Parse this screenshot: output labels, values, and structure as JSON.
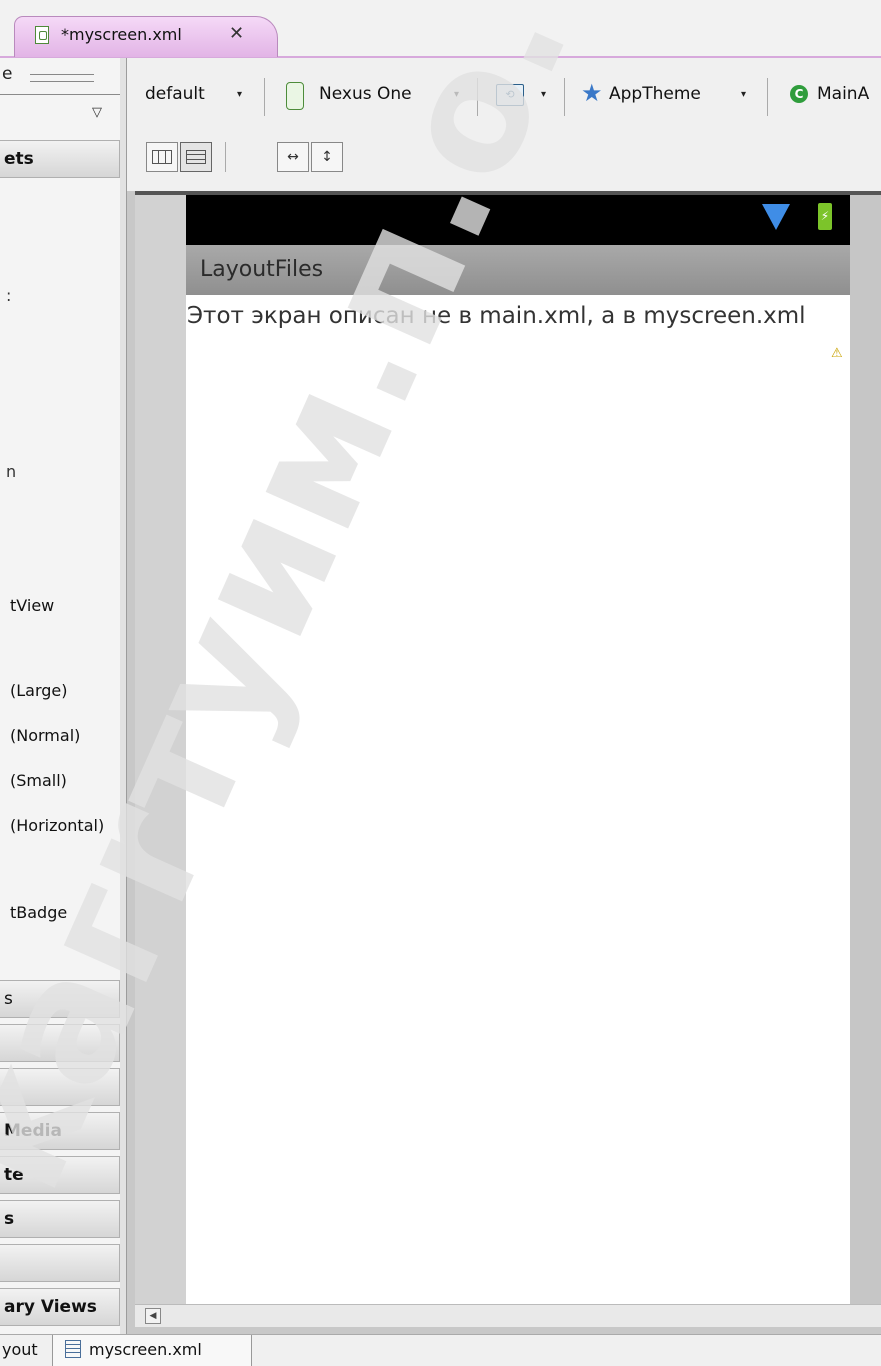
{
  "editor_tab": {
    "title": "*myscreen.xml",
    "close_glyph": "✕"
  },
  "palette": {
    "search_fragment": "e",
    "headers": [
      "ets",
      "s",
      "",
      "",
      "Media",
      "te",
      "s",
      "",
      "ary Views"
    ],
    "items": [
      "tView",
      "(Large)",
      "(Normal)",
      "(Small)",
      "(Horizontal)",
      "tBadge"
    ],
    "fragments": [
      ":",
      "n"
    ]
  },
  "toolbar": {
    "config": "default",
    "device": "Nexus One",
    "theme": "AppTheme",
    "activity": "MainA",
    "dropdown_glyph": "▾"
  },
  "preview": {
    "app_title": "LayoutFiles",
    "content_text": "Этот экран описан не в main.xml, а в myscreen.xml",
    "warning_glyph": "⚠",
    "battery_glyph": "⚡"
  },
  "bottom_tabs": {
    "layout": "yout",
    "xml": "myscreen.xml"
  },
  "watermark": "kaгrтуим.п.о.",
  "colors": {
    "tab_active": "#e2b4e6",
    "wifi": "#3f8de6",
    "battery": "#7cc42a",
    "actionbar": "#9b9b9b"
  }
}
